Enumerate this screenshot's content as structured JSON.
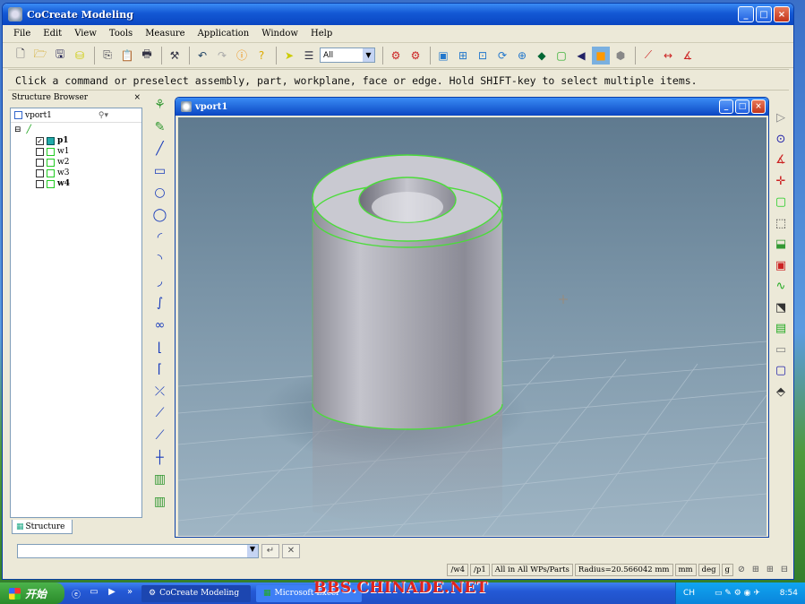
{
  "window": {
    "title": "CoCreate Modeling"
  },
  "menu": [
    "File",
    "Edit",
    "View",
    "Tools",
    "Measure",
    "Application",
    "Window",
    "Help"
  ],
  "toolbar": {
    "filter_select": "All",
    "icons": [
      "new-file-icon",
      "open-folder-icon",
      "save-icon",
      "database-icon",
      "copy-icon",
      "paste-icon",
      "print-icon",
      "tool-icon",
      "undo-icon",
      "redo-icon",
      "info-icon",
      "help-icon",
      "select-arrow-icon",
      "select-list-icon",
      "dropdown-icon",
      "part-icon",
      "part2-icon",
      "fit-icon",
      "zoom-icon",
      "zoom-area-icon",
      "rotate-icon",
      "zoom-in-icon",
      "shade-icon",
      "frame-icon",
      "prev-icon",
      "wireframe-icon",
      "edges-icon",
      "measure1-icon",
      "measure2-icon",
      "measure3-icon"
    ]
  },
  "prompt": "Click a command or preselect assembly, part, workplane, face or edge. Hold SHIFT-key to select multiple items.",
  "structure_browser": {
    "title": "Structure Browser",
    "close": "×",
    "top_label": "vport1",
    "items": [
      {
        "label": "p1",
        "checked": true,
        "bold": true,
        "type": "part"
      },
      {
        "label": "w1",
        "checked": false,
        "bold": false,
        "type": "workplane"
      },
      {
        "label": "w2",
        "checked": false,
        "bold": false,
        "type": "workplane"
      },
      {
        "label": "w3",
        "checked": false,
        "bold": false,
        "type": "workplane"
      },
      {
        "label": "w4",
        "checked": false,
        "bold": true,
        "type": "workplane"
      }
    ],
    "tab": "Structure"
  },
  "viewport": {
    "title": "vport1"
  },
  "status": {
    "wp": "/w4",
    "part": "/p1",
    "scope": "All in All WPs/Parts",
    "radius": "Radius=20.566042 mm",
    "unit_len": "mm",
    "unit_angle": "deg",
    "unit_mass": "g"
  },
  "taskbar": {
    "start": "开始",
    "tasks": [
      "CoCreate Modeling",
      "Microsoft Excel"
    ],
    "lang": "CH",
    "time": "8:54"
  },
  "watermark": "BBS.CHINADE.NET",
  "colors": {
    "title_blue": "#0a46c2",
    "edge_green": "#4bdc3a",
    "viewport_bg": "#7993a6"
  }
}
